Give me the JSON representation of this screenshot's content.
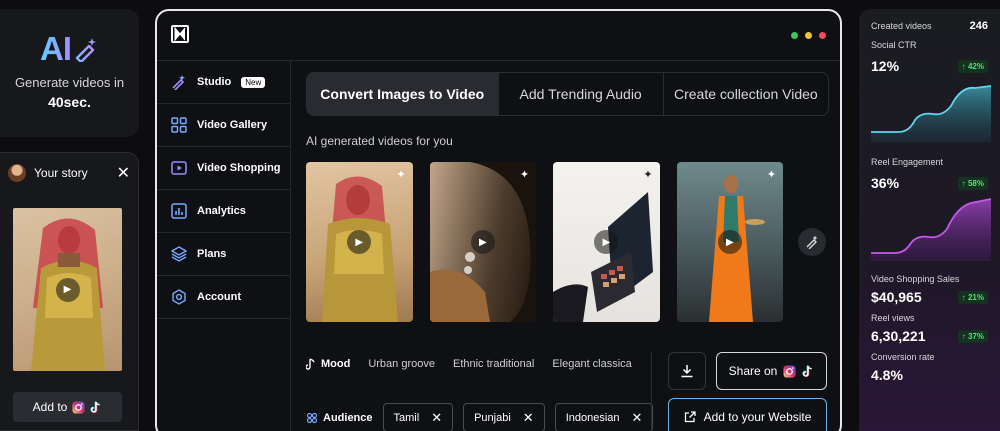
{
  "ai_card": {
    "logo_text": "AI",
    "subtitle": "Generate videos in",
    "highlight": "40sec."
  },
  "story": {
    "title": "Your story",
    "add_label": "Add to"
  },
  "window": {
    "sidebar": [
      {
        "label": "Studio",
        "badge": "New"
      },
      {
        "label": "Video Gallery"
      },
      {
        "label": "Video Shopping"
      },
      {
        "label": "Analytics"
      },
      {
        "label": "Plans"
      },
      {
        "label": "Account"
      }
    ],
    "tabs": [
      "Convert Images to Video",
      "Add Trending Audio",
      "Create collection Video"
    ],
    "section_title": "AI generated videos for you",
    "mood": {
      "label": "Mood",
      "options": [
        "Urban groove",
        "Ethnic traditional",
        "Elegant classica"
      ]
    },
    "audience": {
      "label": "Audience",
      "chips": [
        "Tamil",
        "Punjabi",
        "Indonesian"
      ]
    },
    "share_label": "Share on",
    "website_label": "Add to your Website"
  },
  "stats": {
    "created_videos_label": "Created videos",
    "created_videos_value": "246",
    "social_ctr_label": "Social CTR",
    "social_ctr_value": "12%",
    "social_ctr_change": "42%",
    "reel_engagement_label": "Reel Engagement",
    "reel_engagement_value": "36%",
    "reel_engagement_change": "58%",
    "video_shopping_label": "Video Shopping Sales",
    "video_shopping_value": "$40,965",
    "video_shopping_change": "21%",
    "reel_views_label": "Reel views",
    "reel_views_value": "6,30,221",
    "reel_views_change": "37%",
    "conversion_label": "Conversion rate",
    "conversion_value": "4.8%"
  },
  "colors": {
    "accent_blue": "#5fd0ff",
    "accent_purple": "#a48cff",
    "positive_green": "#4be27a",
    "dot_green": "#3ec75a",
    "dot_yellow": "#f1c232",
    "dot_red": "#ef4b5d"
  }
}
